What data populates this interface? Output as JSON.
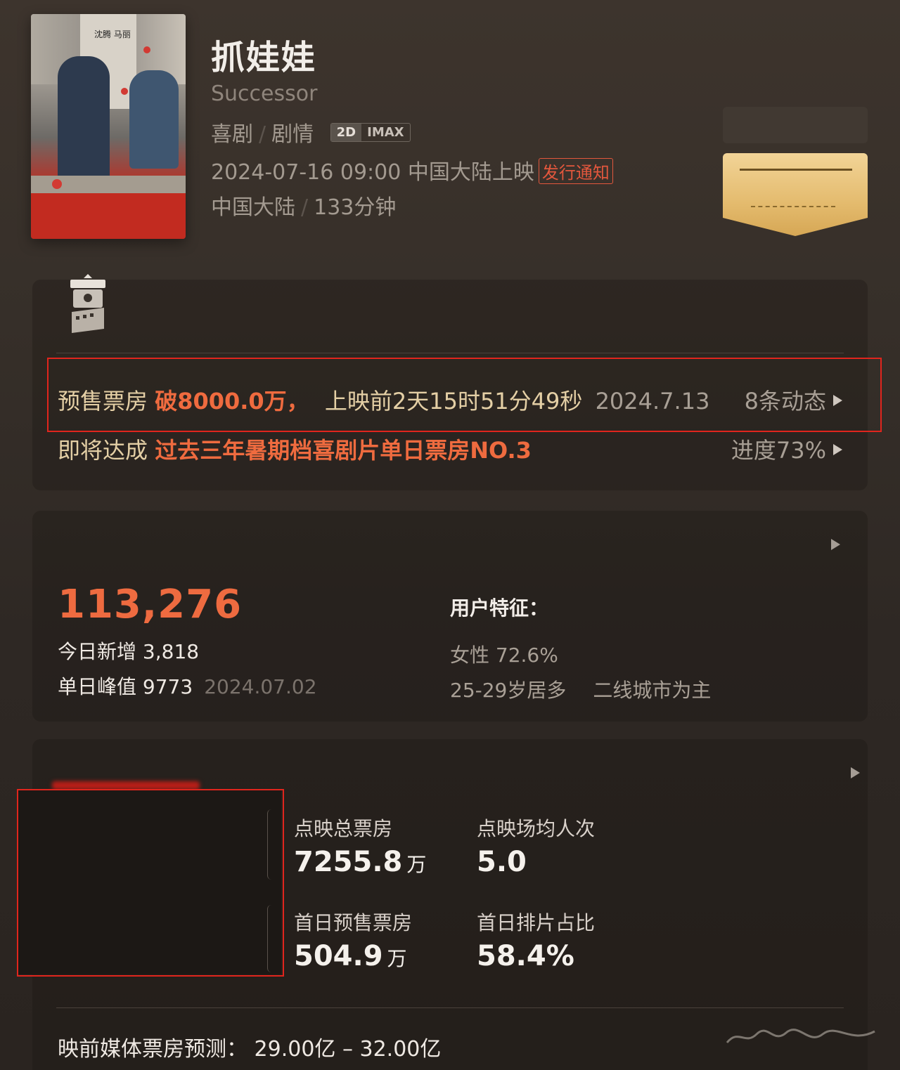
{
  "movie": {
    "title": "抓娃娃",
    "english_title": "Successor",
    "genre1": "喜剧",
    "genre2": "剧情",
    "format_2d": "2D",
    "format_imax": "IMAX",
    "release_datetime": "2024-07-16 09:00",
    "release_region": "中国大陆上映",
    "release_notice": "发行通知",
    "country": "中国大陆",
    "duration": "133分钟",
    "poster_text": "沈腾 马丽"
  },
  "presale": {
    "label": "预售票房",
    "value": "破8000.0万，",
    "countdown": "上映前2天15时51分49秒",
    "date": "2024.7.13",
    "updates": "8条动态"
  },
  "milestone": {
    "prefix": "即将达成",
    "achievement": "过去三年暑期档喜剧片单日票房NO.3",
    "progress": "进度73%"
  },
  "wantsee": {
    "total": "113,276",
    "today_label": "今日新增",
    "today_value": "3,818",
    "peak_label": "单日峰值",
    "peak_value": "9773",
    "peak_date": "2024.07.02",
    "user_title": "用户特征：",
    "female": "女性 72.6%",
    "age": "25-29岁居多",
    "city": "二线城市为主"
  },
  "preview": {
    "box_label": "点映总票房",
    "box_value": "7255.8",
    "box_unit": "万",
    "avg_label": "点映场均人次",
    "avg_value": "5.0",
    "firstday_label": "首日预售票房",
    "firstday_value": "504.9",
    "firstday_unit": "万",
    "share_label": "首日排片占比",
    "share_value": "58.4%"
  },
  "forecast": {
    "label": "映前媒体票房预测：",
    "value": "29.00亿 – 32.00亿"
  },
  "colors": {
    "accent": "#ef6b3f",
    "highlight_box": "#e0251d",
    "gold": "#e4bb6e"
  }
}
